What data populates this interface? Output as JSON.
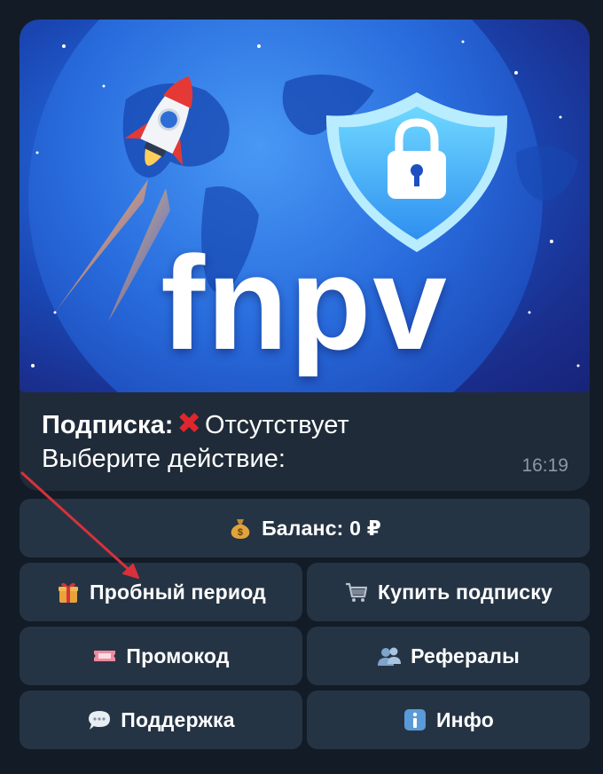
{
  "banner": {
    "logo_text": "fnpv"
  },
  "message": {
    "subscription_label": "Подписка:",
    "status_icon": "cross-mark-icon",
    "status_text": "Отсутствует",
    "prompt": "Выберите действие:",
    "time": "16:19"
  },
  "keyboard": {
    "balance": {
      "icon": "money-bag-icon",
      "label": "Баланс: 0 ₽"
    },
    "trial": {
      "icon": "gift-icon",
      "label": "Пробный период"
    },
    "buy": {
      "icon": "shopping-cart-icon",
      "label": "Купить подписку"
    },
    "promo": {
      "icon": "ticket-icon",
      "label": "Промокод"
    },
    "referrals": {
      "icon": "people-icon",
      "label": "Рефералы"
    },
    "support": {
      "icon": "speech-bubble-icon",
      "label": "Поддержка"
    },
    "info": {
      "icon": "info-icon",
      "label": "Инфо"
    }
  },
  "colors": {
    "background": "#131c26",
    "bubble": "#1f2b38",
    "button": "#253444",
    "annotation_arrow": "#d8313b"
  }
}
